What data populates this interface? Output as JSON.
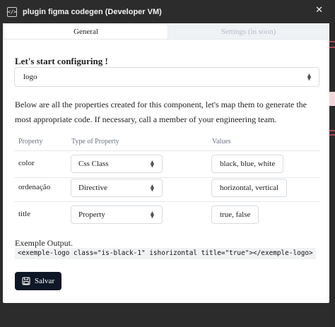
{
  "window": {
    "app_icon": "</>",
    "title": "plugin figma codegen (Developer VM)",
    "close": "✕"
  },
  "tabs": [
    {
      "label": "General",
      "active": true
    },
    {
      "label": "Settings (in soon)",
      "active": false
    }
  ],
  "config": {
    "heading": "Let's start configuring !",
    "component_select_value": "logo",
    "description": "Below are all the properties created for this component, let's map them to generate the most appropriate code. If necessary, call a member of your engineering team."
  },
  "table": {
    "headers": [
      "Property",
      "Type of Property",
      "Values"
    ],
    "rows": [
      {
        "property": "color",
        "type": "Css Class",
        "values": "black, blue, white"
      },
      {
        "property": "ordenação",
        "type": "Directive",
        "values": "horizontal, vertical"
      },
      {
        "property": "title",
        "type": "Property",
        "values": "true, false"
      }
    ]
  },
  "output": {
    "label": "Exemple Output.",
    "code": "<exemple-logo class=\"is-black-1\" ishorizontal title=\"true\"></exemple-logo>"
  },
  "save_button": {
    "label": "Salvar",
    "icon": "save-icon"
  },
  "colors": {
    "button_bg": "#0e1726",
    "titlebar_bg": "#2c2c2c",
    "tab_inactive_text": "#b5bcc6"
  }
}
